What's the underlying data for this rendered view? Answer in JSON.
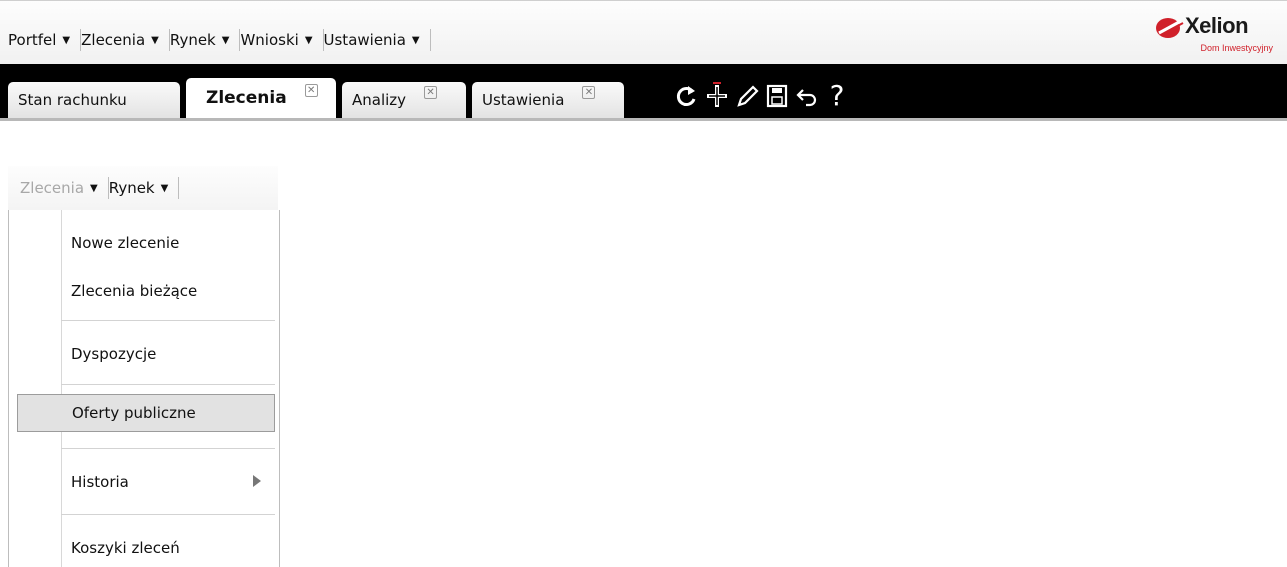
{
  "top_menu": {
    "items": [
      {
        "label": "Portfel"
      },
      {
        "label": "Zlecenia"
      },
      {
        "label": "Rynek"
      },
      {
        "label": "Wnioski"
      },
      {
        "label": "Ustawienia"
      }
    ]
  },
  "logo": {
    "name": "Xelion",
    "subtitle": "Dom Inwestycyjny",
    "icon": "xelion-logo-mark",
    "accent": "#d0202a"
  },
  "tabs": [
    {
      "label": "Stan rachunku",
      "closable": false
    },
    {
      "label": "Zlecenia",
      "closable": true,
      "active": true
    },
    {
      "label": "Analizy",
      "closable": true
    },
    {
      "label": "Ustawienia",
      "closable": true
    }
  ],
  "tab_close_glyph": "✕",
  "toolbar_icons": [
    "refresh-icon",
    "add-icon",
    "edit-icon",
    "save-icon",
    "undo-icon",
    "help-icon"
  ],
  "toolbar_help": "?",
  "sub_menu": {
    "items": [
      {
        "label": "Zlecenia",
        "disabled": true
      },
      {
        "label": "Rynek"
      }
    ]
  },
  "dropdown": {
    "items": [
      {
        "label": "Nowe zlecenie"
      },
      {
        "label": "Zlecenia bieżące"
      },
      {
        "label": "Dyspozycje"
      },
      {
        "label": "Oferty publiczne",
        "highlighted": true
      },
      {
        "label": "Historia",
        "submenu": true
      },
      {
        "label": "Koszyki zleceń"
      }
    ]
  },
  "caret_glyph": "▼"
}
